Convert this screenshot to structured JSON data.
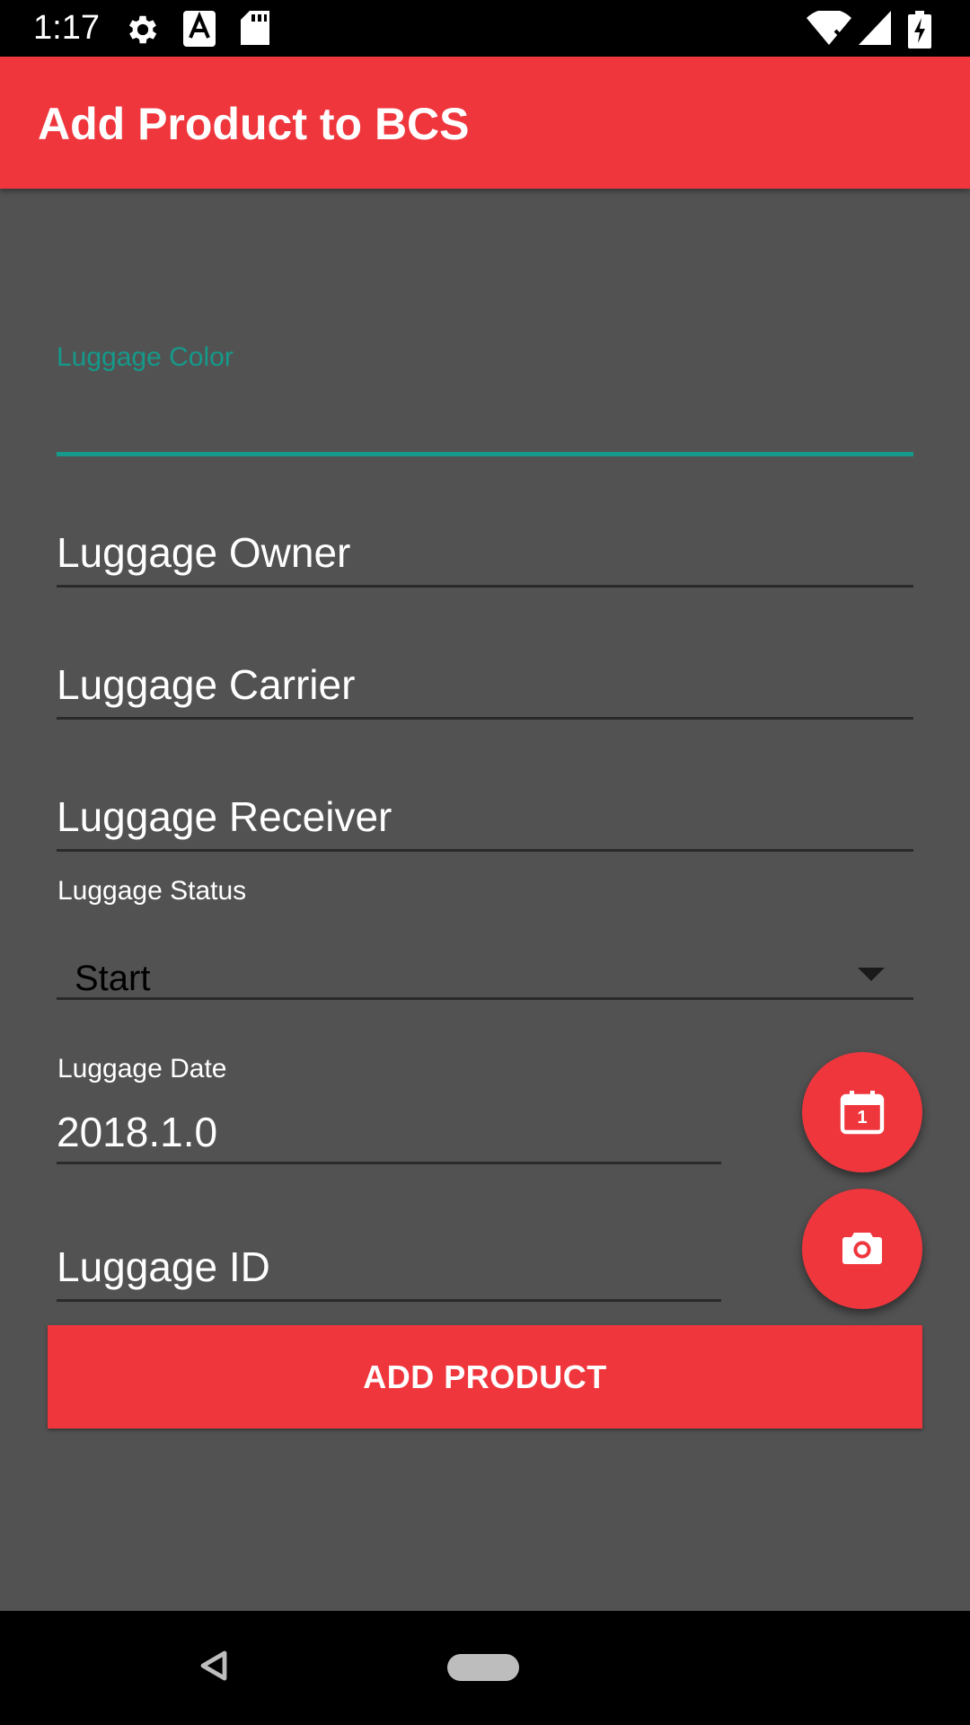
{
  "status_bar": {
    "time": "1:17",
    "icons": [
      "gear-icon",
      "font-a-icon",
      "sd-card-icon",
      "wifi-icon",
      "signal-icon",
      "battery-charging-icon"
    ]
  },
  "app_bar": {
    "title": "Add Product to BCS",
    "color": "#ef363d"
  },
  "form": {
    "color_label": "Luggage Color",
    "color_value": "",
    "owner_placeholder": "Luggage Owner",
    "carrier_placeholder": "Luggage Carrier",
    "receiver_placeholder": "Luggage Receiver",
    "status_label": "Luggage Status",
    "status_selected": "Start",
    "date_label": "Luggage Date",
    "date_value": "2018.1.0",
    "id_placeholder": "Luggage ID",
    "accent_color": "#14998a"
  },
  "fabs": {
    "calendar_icon": "calendar-icon",
    "calendar_day": "1",
    "camera_icon": "camera-icon"
  },
  "actions": {
    "add_product_label": "ADD PRODUCT"
  },
  "nav_bar": {
    "icons": [
      "back-icon",
      "home-pill-icon"
    ]
  }
}
